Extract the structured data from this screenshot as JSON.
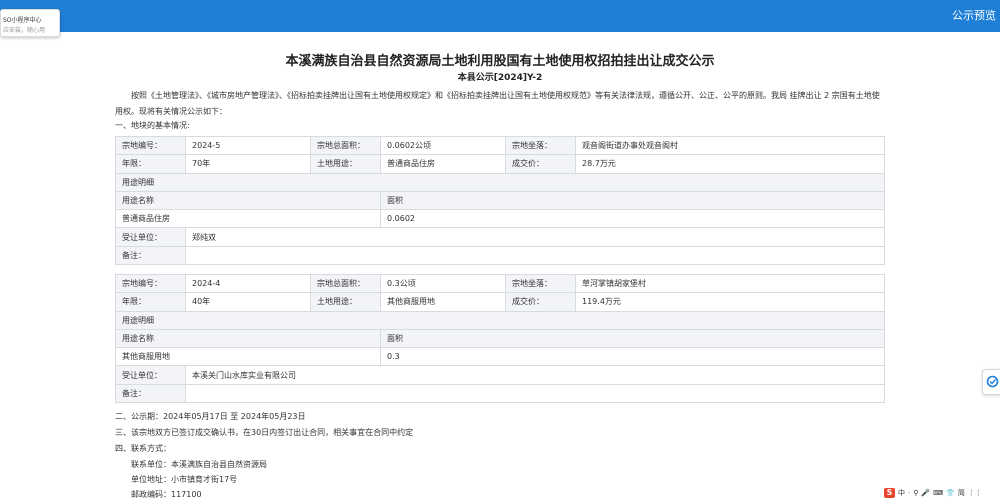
{
  "header": {
    "right_label": "公示预览"
  },
  "popup": {
    "line1": "SO小程序中心",
    "line2": "应安装，随心用"
  },
  "doc": {
    "title": "本溪满族自治县自然资源局土地利用股国有土地使用权招拍挂出让成交公示",
    "subtitle": "本县公示[2024]Y-2",
    "intro": "按照《土地管理法》、《城市房地产管理法》、《招标拍卖挂牌出让国有土地使用权规定》和《招标拍卖挂牌出让国有土地使用权规范》等有关法律法规，遵循公开、公正、公平的原则。我局 挂牌出让 2 宗国有土地使用权。现将有关情况公示如下：",
    "section1": "一、地块的基本情况:",
    "section2": "二、公示期：2024年05月17日 至 2024年05月23日",
    "section3": "三、该宗地双方已签订成交确认书，在30日内签订出让合同，相关事宜在合同中约定",
    "section4": "四、联系方式：",
    "contacts": [
      "联系单位：本溪满族自治县自然资源局",
      "单位地址：小市镇育才街17号",
      "邮政编码：117100"
    ]
  },
  "labels": {
    "parcel_no": "宗地编号：",
    "total_area": "宗地总面积：",
    "location": "宗地坐落：",
    "term": "年限：",
    "land_use": "土地用途：",
    "price": "成交价：",
    "use_detail": "用途明细",
    "use_name": "用途名称",
    "area": "面积",
    "buyer": "受让单位：",
    "remarks": "备注："
  },
  "parcels": [
    {
      "no": "2024-5",
      "area": "0.0602公顷",
      "location": "观音阁街道办事处观音阁村",
      "term": "70年",
      "use": "普通商品住房",
      "price": "28.7万元",
      "detail_name": "普通商品住房",
      "detail_area": "0.0602",
      "buyer": "郑纯双",
      "remarks": ""
    },
    {
      "no": "2024-4",
      "area": "0.3公顷",
      "location": "草河掌镇胡家堡村",
      "term": "40年",
      "use": "其他商服用地",
      "price": "119.4万元",
      "detail_name": "其他商服用地",
      "detail_area": "0.3",
      "buyer": "本溪关门山水库实业有限公司",
      "remarks": ""
    }
  ],
  "ime": {
    "items": [
      "中",
      "·",
      "⚲",
      "🎤",
      "⌨",
      "👕",
      "简",
      "⋮⋮"
    ]
  },
  "colors": {
    "topbar": "#1f7fd6",
    "header_cell": "#f2f4f7",
    "border": "#d7dbe0"
  }
}
